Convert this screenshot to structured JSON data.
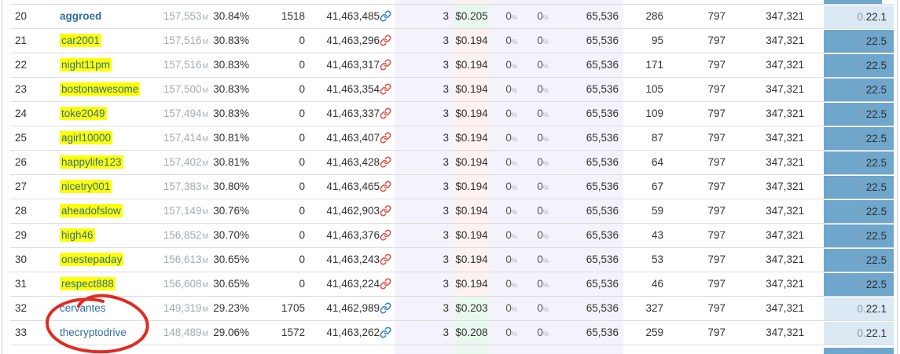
{
  "table": {
    "rows": [
      {
        "rank": "20",
        "username": "aggroed",
        "bold": true,
        "highlighted": false,
        "votes": "157,553",
        "votes_suffix": "M",
        "percent": "30.84%",
        "missed": "1518",
        "last_block": "41,463,485",
        "link_color": "blue",
        "fee": "3",
        "price": "$0.205",
        "price_bg": "green",
        "apr1": "0",
        "apr2": "0",
        "block_size": "65,536",
        "count": "286",
        "col_b": "797",
        "col_c": "347,321",
        "version_prefix": "0.",
        "version": "22.1",
        "version_style": "light"
      },
      {
        "rank": "21",
        "username": "car2001",
        "bold": false,
        "highlighted": true,
        "votes": "157,516",
        "votes_suffix": "M",
        "percent": "30.83%",
        "missed": "0",
        "last_block": "41,463,296",
        "link_color": "red",
        "fee": "3",
        "price": "$0.194",
        "price_bg": "pink",
        "apr1": "0",
        "apr2": "0",
        "block_size": "65,536",
        "count": "95",
        "col_b": "797",
        "col_c": "347,321",
        "version_prefix": "0.",
        "version": "22.5",
        "version_style": "dark"
      },
      {
        "rank": "22",
        "username": "night11pm",
        "bold": false,
        "highlighted": true,
        "votes": "157,516",
        "votes_suffix": "M",
        "percent": "30.83%",
        "missed": "0",
        "last_block": "41,463,317",
        "link_color": "red",
        "fee": "3",
        "price": "$0.194",
        "price_bg": "pink",
        "apr1": "0",
        "apr2": "0",
        "block_size": "65,536",
        "count": "171",
        "col_b": "797",
        "col_c": "347,321",
        "version_prefix": "0.",
        "version": "22.5",
        "version_style": "dark"
      },
      {
        "rank": "23",
        "username": "bostonawesome",
        "bold": false,
        "highlighted": true,
        "votes": "157,500",
        "votes_suffix": "M",
        "percent": "30.83%",
        "missed": "0",
        "last_block": "41,463,354",
        "link_color": "red",
        "fee": "3",
        "price": "$0.194",
        "price_bg": "pink",
        "apr1": "0",
        "apr2": "0",
        "block_size": "65,536",
        "count": "105",
        "col_b": "797",
        "col_c": "347,321",
        "version_prefix": "0.",
        "version": "22.5",
        "version_style": "dark"
      },
      {
        "rank": "24",
        "username": "toke2049",
        "bold": false,
        "highlighted": true,
        "votes": "157,494",
        "votes_suffix": "M",
        "percent": "30.83%",
        "missed": "0",
        "last_block": "41,463,337",
        "link_color": "red",
        "fee": "3",
        "price": "$0.194",
        "price_bg": "pink",
        "apr1": "0",
        "apr2": "0",
        "block_size": "65,536",
        "count": "109",
        "col_b": "797",
        "col_c": "347,321",
        "version_prefix": "0.",
        "version": "22.5",
        "version_style": "dark"
      },
      {
        "rank": "25",
        "username": "agirl10000",
        "bold": false,
        "highlighted": true,
        "votes": "157,414",
        "votes_suffix": "M",
        "percent": "30.81%",
        "missed": "0",
        "last_block": "41,463,407",
        "link_color": "red",
        "fee": "3",
        "price": "$0.194",
        "price_bg": "pink",
        "apr1": "0",
        "apr2": "0",
        "block_size": "65,536",
        "count": "87",
        "col_b": "797",
        "col_c": "347,321",
        "version_prefix": "0.",
        "version": "22.5",
        "version_style": "dark"
      },
      {
        "rank": "26",
        "username": "happylife123",
        "bold": false,
        "highlighted": true,
        "votes": "157,402",
        "votes_suffix": "M",
        "percent": "30.81%",
        "missed": "0",
        "last_block": "41,463,428",
        "link_color": "red",
        "fee": "3",
        "price": "$0.194",
        "price_bg": "pink",
        "apr1": "0",
        "apr2": "0",
        "block_size": "65,536",
        "count": "64",
        "col_b": "797",
        "col_c": "347,321",
        "version_prefix": "0.",
        "version": "22.5",
        "version_style": "dark"
      },
      {
        "rank": "27",
        "username": "nicetry001",
        "bold": false,
        "highlighted": true,
        "votes": "157,383",
        "votes_suffix": "M",
        "percent": "30.80%",
        "missed": "0",
        "last_block": "41,463,465",
        "link_color": "red",
        "fee": "3",
        "price": "$0.194",
        "price_bg": "pink",
        "apr1": "0",
        "apr2": "0",
        "block_size": "65,536",
        "count": "67",
        "col_b": "797",
        "col_c": "347,321",
        "version_prefix": "0.",
        "version": "22.5",
        "version_style": "dark"
      },
      {
        "rank": "28",
        "username": "aheadofslow",
        "bold": false,
        "highlighted": true,
        "votes": "157,149",
        "votes_suffix": "M",
        "percent": "30.76%",
        "missed": "0",
        "last_block": "41,462,903",
        "link_color": "red",
        "fee": "3",
        "price": "$0.194",
        "price_bg": "pink",
        "apr1": "0",
        "apr2": "0",
        "block_size": "65,536",
        "count": "59",
        "col_b": "797",
        "col_c": "347,321",
        "version_prefix": "0.",
        "version": "22.5",
        "version_style": "dark"
      },
      {
        "rank": "29",
        "username": "high46",
        "bold": false,
        "highlighted": true,
        "votes": "156,852",
        "votes_suffix": "M",
        "percent": "30.70%",
        "missed": "0",
        "last_block": "41,463,376",
        "link_color": "red",
        "fee": "3",
        "price": "$0.194",
        "price_bg": "pink",
        "apr1": "0",
        "apr2": "0",
        "block_size": "65,536",
        "count": "43",
        "col_b": "797",
        "col_c": "347,321",
        "version_prefix": "0.",
        "version": "22.5",
        "version_style": "dark"
      },
      {
        "rank": "30",
        "username": "onestepaday",
        "bold": false,
        "highlighted": true,
        "votes": "156,613",
        "votes_suffix": "M",
        "percent": "30.65%",
        "missed": "0",
        "last_block": "41,463,243",
        "link_color": "red",
        "fee": "3",
        "price": "$0.194",
        "price_bg": "pink",
        "apr1": "0",
        "apr2": "0",
        "block_size": "65,536",
        "count": "53",
        "col_b": "797",
        "col_c": "347,321",
        "version_prefix": "0.",
        "version": "22.5",
        "version_style": "dark"
      },
      {
        "rank": "31",
        "username": "respect888",
        "bold": false,
        "highlighted": true,
        "votes": "156,608",
        "votes_suffix": "M",
        "percent": "30.65%",
        "missed": "0",
        "last_block": "41,463,224",
        "link_color": "red",
        "fee": "3",
        "price": "$0.194",
        "price_bg": "pink",
        "apr1": "0",
        "apr2": "0",
        "block_size": "65,536",
        "count": "46",
        "col_b": "797",
        "col_c": "347,321",
        "version_prefix": "0.",
        "version": "22.5",
        "version_style": "dark"
      },
      {
        "rank": "32",
        "username": "cervantes",
        "bold": false,
        "highlighted": false,
        "votes": "149,319",
        "votes_suffix": "M",
        "percent": "29.23%",
        "missed": "1705",
        "last_block": "41,462,989",
        "link_color": "blue",
        "fee": "3",
        "price": "$0.203",
        "price_bg": "green",
        "apr1": "0",
        "apr2": "0",
        "block_size": "65,536",
        "count": "327",
        "col_b": "797",
        "col_c": "347,321",
        "version_prefix": "0.",
        "version": "22.1",
        "version_style": "light"
      },
      {
        "rank": "33",
        "username": "thecryptodrive",
        "bold": false,
        "highlighted": false,
        "votes": "148,489",
        "votes_suffix": "M",
        "percent": "29.06%",
        "missed": "1572",
        "last_block": "41,463,262",
        "link_color": "blue",
        "fee": "3",
        "price": "$0.208",
        "price_bg": "green",
        "apr1": "0",
        "apr2": "0",
        "block_size": "65,536",
        "count": "259",
        "col_b": "797",
        "col_c": "347,321",
        "version_prefix": "0.",
        "version": "22.1",
        "version_style": "light"
      }
    ]
  },
  "icons": {
    "link": "chain-link-icon"
  },
  "annotation": {
    "shape": "hand-drawn red ellipse",
    "color": "#e02b20",
    "around": "usernames cervantes and thecryptodrive (rows 32-33)"
  },
  "colors": {
    "highlight_yellow": "#ffff00",
    "link_blue": "#2e6da4",
    "icon_blue": "#3a82c4",
    "icon_red": "#e0534a",
    "price_green_bg": "#e9f8ee",
    "price_pink_bg": "#fdf2ef",
    "band_lavender": "#f4f3fc",
    "version_light_bg": "#dbe9f4",
    "version_dark_bg": "#6fa6cc",
    "votes_grey": "#a6abb0",
    "row_border": "#dddddd"
  }
}
